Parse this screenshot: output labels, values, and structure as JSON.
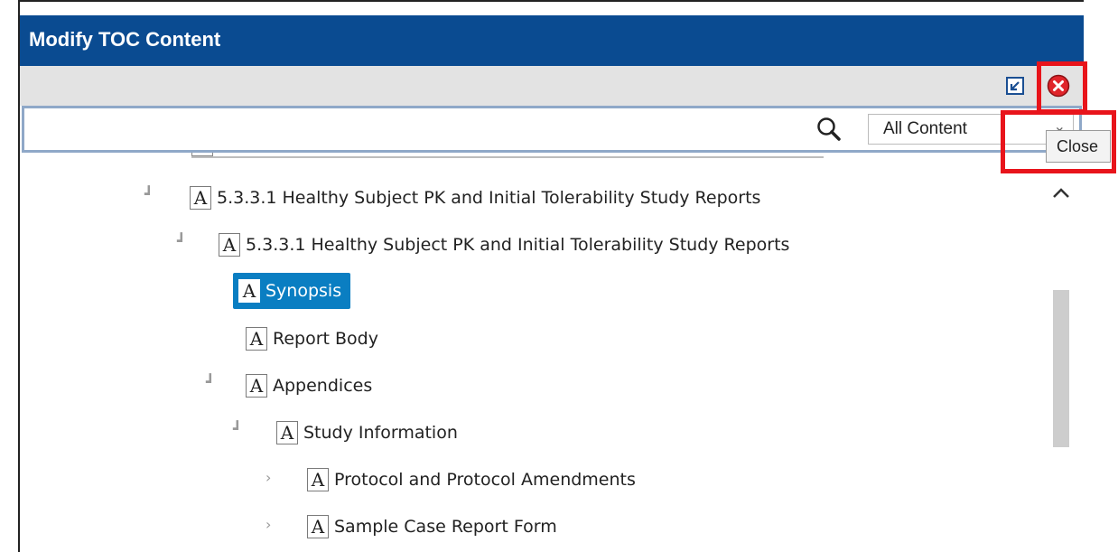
{
  "dialog": {
    "title": "Modify TOC Content"
  },
  "toolbar": {
    "restore_icon": "restore-window-icon",
    "close_icon": "close-icon",
    "close_color": "#e0252b",
    "tooltip": "Close"
  },
  "search": {
    "value": "",
    "icon": "search-icon",
    "filter_selected": "All Content"
  },
  "colors": {
    "titlebar": "#0a4b91",
    "selection": "#0a7ec2",
    "highlight": "#e8141b"
  },
  "tree": {
    "items": [
      {
        "label": "5.3.3.1 Healthy Subject PK and Initial Tolerability Study Reports",
        "expander": "collapse",
        "selected": false
      },
      {
        "label": "5.3.3.1 Healthy Subject PK and Initial Tolerability Study Reports",
        "expander": "collapse",
        "selected": false
      },
      {
        "label": "Synopsis",
        "expander": "",
        "selected": true
      },
      {
        "label": "Report Body",
        "expander": "",
        "selected": false
      },
      {
        "label": "Appendices",
        "expander": "collapse",
        "selected": false
      },
      {
        "label": "Study Information",
        "expander": "collapse",
        "selected": false
      },
      {
        "label": "Protocol and Protocol Amendments",
        "expander": "expand",
        "selected": false
      },
      {
        "label": "Sample Case Report Form",
        "expander": "expand",
        "selected": false
      }
    ],
    "badge_letter": "A"
  }
}
